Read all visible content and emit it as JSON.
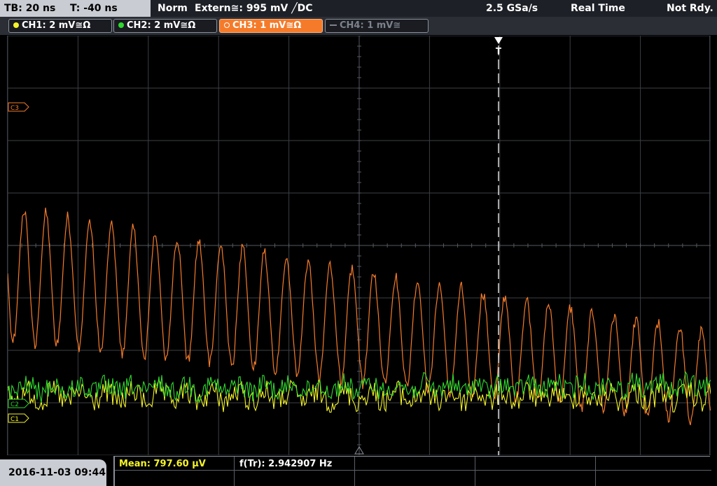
{
  "topbar": {
    "timebase": "TB: 20 ns",
    "trigger_time": "T: -40 ns",
    "trigger_mode": "Norm",
    "trigger_source": "Extern≅: 995 mV ╱DC",
    "sample_rate": "2.5 GSa/s",
    "acquisition": "Real Time",
    "status": "Not Rdy."
  },
  "channels": [
    {
      "label": "CH1: 2 mV≅Ω",
      "color": "#f4f42a",
      "state": "on"
    },
    {
      "label": "CH2: 2 mV≅Ω",
      "color": "#2fd82f",
      "state": "on"
    },
    {
      "label": "CH3: 1 mV≅Ω",
      "color": "#f57b2a",
      "state": "active"
    },
    {
      "label": "CH4: 1 mV≅",
      "color": "#7d818a",
      "state": "off"
    }
  ],
  "markers": {
    "c3": "C3",
    "c2": "C2",
    "c1": "C1",
    "trigger": "T"
  },
  "measurements": {
    "mean": "Mean: 797.60 µV",
    "freq": "f(Tr): 2.942907 Hz"
  },
  "timestamp": "2016-11-03 09:44",
  "colors": {
    "ch1": "#f4f42a",
    "ch2": "#2fd82f",
    "ch3": "#f57b2a",
    "grid": "#3c3f45",
    "center": "#55585e"
  }
}
